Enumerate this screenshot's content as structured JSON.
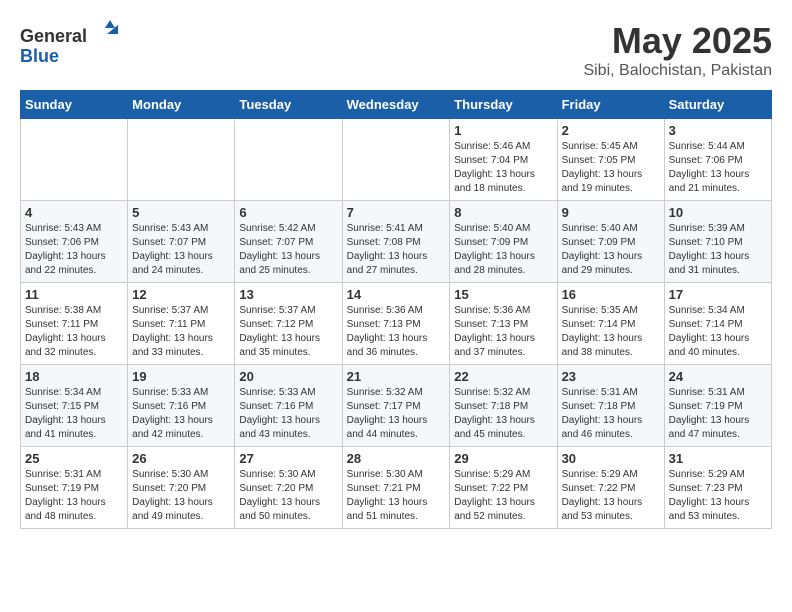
{
  "logo": {
    "line1": "General",
    "line2": "Blue"
  },
  "title": "May 2025",
  "subtitle": "Sibi, Balochistan, Pakistan",
  "weekdays": [
    "Sunday",
    "Monday",
    "Tuesday",
    "Wednesday",
    "Thursday",
    "Friday",
    "Saturday"
  ],
  "weeks": [
    [
      {
        "day": "",
        "info": ""
      },
      {
        "day": "",
        "info": ""
      },
      {
        "day": "",
        "info": ""
      },
      {
        "day": "",
        "info": ""
      },
      {
        "day": "1",
        "info": "Sunrise: 5:46 AM\nSunset: 7:04 PM\nDaylight: 13 hours\nand 18 minutes."
      },
      {
        "day": "2",
        "info": "Sunrise: 5:45 AM\nSunset: 7:05 PM\nDaylight: 13 hours\nand 19 minutes."
      },
      {
        "day": "3",
        "info": "Sunrise: 5:44 AM\nSunset: 7:06 PM\nDaylight: 13 hours\nand 21 minutes."
      }
    ],
    [
      {
        "day": "4",
        "info": "Sunrise: 5:43 AM\nSunset: 7:06 PM\nDaylight: 13 hours\nand 22 minutes."
      },
      {
        "day": "5",
        "info": "Sunrise: 5:43 AM\nSunset: 7:07 PM\nDaylight: 13 hours\nand 24 minutes."
      },
      {
        "day": "6",
        "info": "Sunrise: 5:42 AM\nSunset: 7:07 PM\nDaylight: 13 hours\nand 25 minutes."
      },
      {
        "day": "7",
        "info": "Sunrise: 5:41 AM\nSunset: 7:08 PM\nDaylight: 13 hours\nand 27 minutes."
      },
      {
        "day": "8",
        "info": "Sunrise: 5:40 AM\nSunset: 7:09 PM\nDaylight: 13 hours\nand 28 minutes."
      },
      {
        "day": "9",
        "info": "Sunrise: 5:40 AM\nSunset: 7:09 PM\nDaylight: 13 hours\nand 29 minutes."
      },
      {
        "day": "10",
        "info": "Sunrise: 5:39 AM\nSunset: 7:10 PM\nDaylight: 13 hours\nand 31 minutes."
      }
    ],
    [
      {
        "day": "11",
        "info": "Sunrise: 5:38 AM\nSunset: 7:11 PM\nDaylight: 13 hours\nand 32 minutes."
      },
      {
        "day": "12",
        "info": "Sunrise: 5:37 AM\nSunset: 7:11 PM\nDaylight: 13 hours\nand 33 minutes."
      },
      {
        "day": "13",
        "info": "Sunrise: 5:37 AM\nSunset: 7:12 PM\nDaylight: 13 hours\nand 35 minutes."
      },
      {
        "day": "14",
        "info": "Sunrise: 5:36 AM\nSunset: 7:13 PM\nDaylight: 13 hours\nand 36 minutes."
      },
      {
        "day": "15",
        "info": "Sunrise: 5:36 AM\nSunset: 7:13 PM\nDaylight: 13 hours\nand 37 minutes."
      },
      {
        "day": "16",
        "info": "Sunrise: 5:35 AM\nSunset: 7:14 PM\nDaylight: 13 hours\nand 38 minutes."
      },
      {
        "day": "17",
        "info": "Sunrise: 5:34 AM\nSunset: 7:14 PM\nDaylight: 13 hours\nand 40 minutes."
      }
    ],
    [
      {
        "day": "18",
        "info": "Sunrise: 5:34 AM\nSunset: 7:15 PM\nDaylight: 13 hours\nand 41 minutes."
      },
      {
        "day": "19",
        "info": "Sunrise: 5:33 AM\nSunset: 7:16 PM\nDaylight: 13 hours\nand 42 minutes."
      },
      {
        "day": "20",
        "info": "Sunrise: 5:33 AM\nSunset: 7:16 PM\nDaylight: 13 hours\nand 43 minutes."
      },
      {
        "day": "21",
        "info": "Sunrise: 5:32 AM\nSunset: 7:17 PM\nDaylight: 13 hours\nand 44 minutes."
      },
      {
        "day": "22",
        "info": "Sunrise: 5:32 AM\nSunset: 7:18 PM\nDaylight: 13 hours\nand 45 minutes."
      },
      {
        "day": "23",
        "info": "Sunrise: 5:31 AM\nSunset: 7:18 PM\nDaylight: 13 hours\nand 46 minutes."
      },
      {
        "day": "24",
        "info": "Sunrise: 5:31 AM\nSunset: 7:19 PM\nDaylight: 13 hours\nand 47 minutes."
      }
    ],
    [
      {
        "day": "25",
        "info": "Sunrise: 5:31 AM\nSunset: 7:19 PM\nDaylight: 13 hours\nand 48 minutes."
      },
      {
        "day": "26",
        "info": "Sunrise: 5:30 AM\nSunset: 7:20 PM\nDaylight: 13 hours\nand 49 minutes."
      },
      {
        "day": "27",
        "info": "Sunrise: 5:30 AM\nSunset: 7:20 PM\nDaylight: 13 hours\nand 50 minutes."
      },
      {
        "day": "28",
        "info": "Sunrise: 5:30 AM\nSunset: 7:21 PM\nDaylight: 13 hours\nand 51 minutes."
      },
      {
        "day": "29",
        "info": "Sunrise: 5:29 AM\nSunset: 7:22 PM\nDaylight: 13 hours\nand 52 minutes."
      },
      {
        "day": "30",
        "info": "Sunrise: 5:29 AM\nSunset: 7:22 PM\nDaylight: 13 hours\nand 53 minutes."
      },
      {
        "day": "31",
        "info": "Sunrise: 5:29 AM\nSunset: 7:23 PM\nDaylight: 13 hours\nand 53 minutes."
      }
    ]
  ]
}
